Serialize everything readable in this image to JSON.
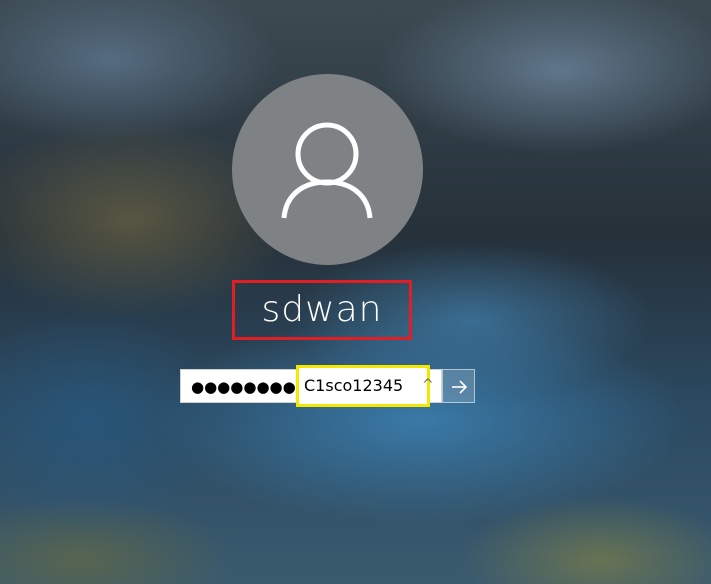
{
  "user": {
    "name": "sdwan",
    "avatar_icon": "user-silhouette-icon"
  },
  "password": {
    "masked_value": "●●●●●●●●●●",
    "revealed_value": "C1sco12345",
    "reveal_icon": "caret-up-icon",
    "reveal_glyph": "^"
  },
  "submit": {
    "icon": "arrow-right-icon"
  },
  "highlight_colors": {
    "username_box": "#e01e24",
    "password_box": "#f5e800"
  }
}
